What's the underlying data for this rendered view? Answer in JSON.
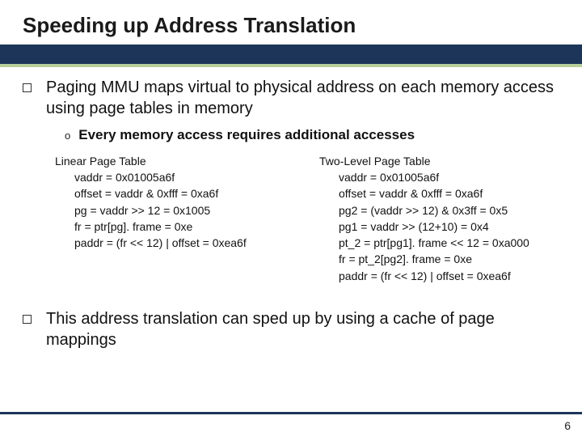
{
  "title": "Speeding up Address Translation",
  "bullets": [
    {
      "text": "Paging MMU maps virtual to physical address on each memory access using page tables in memory",
      "sub": "Every memory access requires additional accesses"
    },
    {
      "text": "This address translation can sped up by using a cache of page mappings"
    }
  ],
  "columns": {
    "left": {
      "title": "Linear Page Table",
      "lines": [
        "vaddr = 0x01005a6f",
        "offset  = vaddr & 0xfff = 0xa6f",
        "pg = vaddr >> 12 = 0x1005",
        "fr = ptr[pg]. frame = 0xe",
        "paddr = (fr << 12) | offset = 0xea6f"
      ]
    },
    "right": {
      "title": "Two-Level Page Table",
      "lines": [
        "vaddr = 0x01005a6f",
        "offset = vaddr & 0xfff = 0xa6f",
        "pg2 = (vaddr >> 12) & 0x3ff = 0x5",
        "pg1 = vaddr >> (12+10) = 0x4",
        "pt_2 = ptr[pg1]. frame << 12 = 0xa000",
        "fr = pt_2[pg2]. frame = 0xe",
        "paddr = (fr << 12) | offset = 0xea6f"
      ]
    }
  },
  "page_number": "6"
}
